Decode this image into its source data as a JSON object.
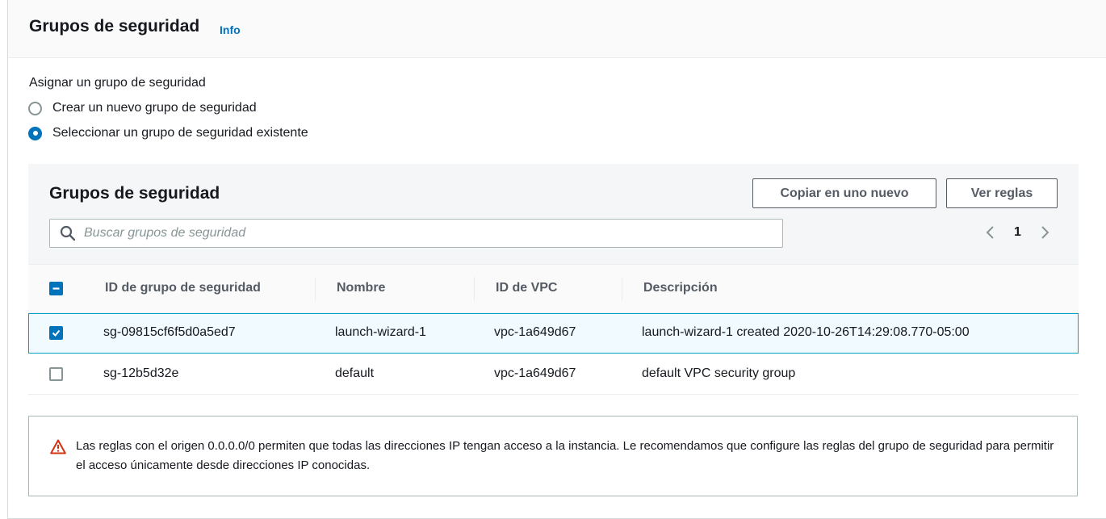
{
  "section": {
    "title": "Grupos de seguridad",
    "info_label": "Info"
  },
  "assign": {
    "label": "Asignar un grupo de seguridad",
    "options": [
      {
        "label": "Crear un nuevo grupo de seguridad",
        "selected": false
      },
      {
        "label": "Seleccionar un grupo de seguridad existente",
        "selected": true
      }
    ]
  },
  "table": {
    "title": "Grupos de seguridad",
    "copy_button": "Copiar en uno nuevo",
    "view_rules_button": "Ver reglas",
    "search_placeholder": "Buscar grupos de seguridad",
    "page": "1",
    "columns": [
      "ID de grupo de seguridad",
      "Nombre",
      "ID de VPC",
      "Descripción"
    ],
    "rows": [
      {
        "id": "sg-09815cf6f5d0a5ed7",
        "name": "launch-wizard-1",
        "vpc": "vpc-1a649d67",
        "description": "launch-wizard-1 created 2020-10-26T14:29:08.770-05:00",
        "checked": true
      },
      {
        "id": "sg-12b5d32e",
        "name": "default",
        "vpc": "vpc-1a649d67",
        "description": "default VPC security group",
        "checked": false
      }
    ]
  },
  "warning": {
    "text": "Las reglas con el origen 0.0.0.0/0 permiten que todas las direcciones IP tengan acceso a la instancia. Le recomendamos que configure las reglas del grupo de seguridad para permitir el acceso únicamente desde direcciones IP conocidas."
  },
  "colors": {
    "accent": "#0073bb",
    "selected_row_border": "#00a1c9",
    "warning": "#d13212"
  }
}
